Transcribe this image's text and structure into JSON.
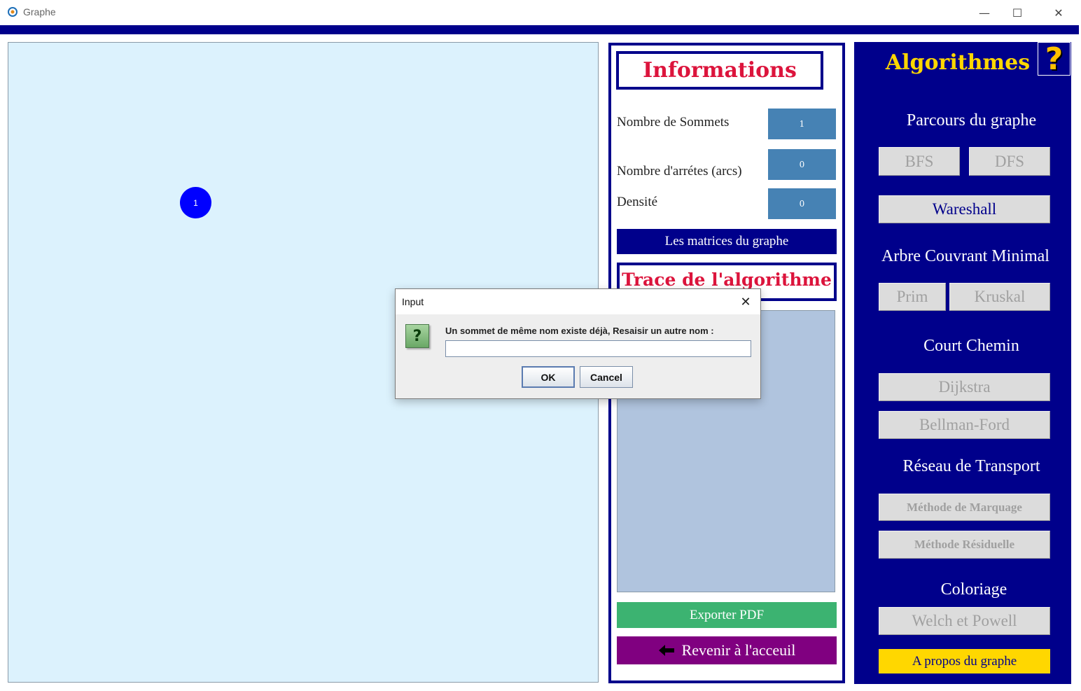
{
  "window": {
    "title": "Graphe",
    "minimize_glyph": "—",
    "maximize_glyph": "☐",
    "close_glyph": "✕"
  },
  "canvas": {
    "background": "#dcf2fd",
    "nodes": [
      {
        "label": "1",
        "color": "#0000ff"
      }
    ]
  },
  "info": {
    "title": "Informations",
    "rows": [
      {
        "label": "Nombre de Sommets",
        "value": "1"
      },
      {
        "label": "Nombre d'arrétes (arcs)",
        "value": "0"
      },
      {
        "label": "Densité",
        "value": "0"
      }
    ],
    "matrices_button": "Les matrices du graphe",
    "trace_title": "Trace de l'algorithme",
    "export_button": "Exporter PDF",
    "back_button": "Revenir à l'acceuil",
    "back_icon": "arrow-left-icon"
  },
  "algorithms": {
    "title": "Algorithmes",
    "help_icon": "question-mark-icon",
    "sections": {
      "parcours": {
        "title": "Parcours du graphe",
        "buttons": [
          "BFS",
          "DFS",
          "Wareshall"
        ]
      },
      "acm": {
        "title": "Arbre Couvrant Minimal",
        "buttons": [
          "Prim",
          "Kruskal"
        ]
      },
      "court_chemin": {
        "title": "Court Chemin",
        "buttons": [
          "Dijkstra",
          "Bellman-Ford"
        ]
      },
      "reseau": {
        "title": "Réseau de Transport",
        "buttons": [
          "Méthode de Marquage",
          "Méthode Résiduelle"
        ]
      },
      "coloriage": {
        "title": "Coloriage",
        "buttons": [
          "Welch et Powell"
        ]
      }
    },
    "about_button": "A propos du graphe"
  },
  "dialog": {
    "title": "Input",
    "message": "Un sommet de même nom existe déjà, Resaisir un autre nom :",
    "input_value": "",
    "ok_label": "OK",
    "cancel_label": "Cancel",
    "icon": "question-icon"
  },
  "colors": {
    "navy": "#00008b",
    "crimson": "#dc143c",
    "steelblue": "#4682b4",
    "trace_bg": "#b0c4de",
    "export_green": "#3cb371",
    "back_purple": "#800080",
    "about_gold": "#ffd700",
    "algo_title_gold": "#ffd700"
  }
}
